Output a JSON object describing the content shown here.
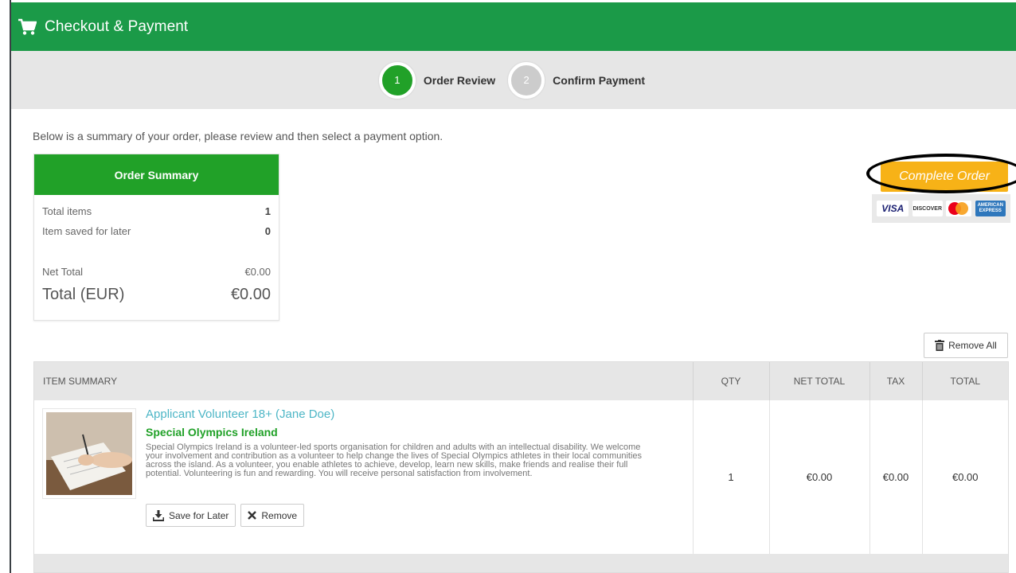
{
  "header": {
    "title": "Checkout & Payment",
    "icon": "cart-icon"
  },
  "steps": [
    {
      "number": "1",
      "label": "Order Review",
      "state": "active"
    },
    {
      "number": "2",
      "label": "Confirm Payment",
      "state": "inactive"
    }
  ],
  "intro_text": "Below is a summary of your order, please review and then select a payment option.",
  "order_summary": {
    "heading": "Order Summary",
    "rows": [
      {
        "label": "Total items",
        "value": "1"
      },
      {
        "label": "Item saved for later",
        "value": "0"
      },
      {
        "label": "Net Total",
        "value": "€0.00"
      },
      {
        "label": "Total (EUR)",
        "value": "€0.00"
      }
    ]
  },
  "actions": {
    "complete_order": "Complete Order",
    "remove_all": "Remove All"
  },
  "payment_cards": {
    "visa": "VISA",
    "discover": "DISCOVER",
    "amex": "AMERICAN EXPRESS"
  },
  "table": {
    "headers": [
      "ITEM SUMMARY",
      "QTY",
      "NET TOTAL",
      "TAX",
      "TOTAL"
    ],
    "rows": [
      {
        "title": "Applicant Volunteer 18+ (Jane Doe)",
        "org": "Special Olympics Ireland",
        "description": "Special Olympics Ireland is a volunteer-led sports organisation for children and adults with an intellectual disability. We welcome your involvement and contribution as a volunteer to help change the lives of Special Olympics athletes in their local communities across the island. As a volunteer, you enable athletes to achieve, develop, learn new skills, make friends and realise their full potential. Volunteering is fun and rewarding. You will receive personal satisfaction from involvement.",
        "qty": "1",
        "net_total": "€0.00",
        "tax": "€0.00",
        "total": "€0.00",
        "save_label": "Save for Later",
        "remove_label": "Remove"
      }
    ]
  },
  "colors": {
    "header_green": "#1b9a48",
    "accent_green": "#21a128",
    "complete_orange": "#f7b217",
    "link_teal": "#4db6c6"
  }
}
